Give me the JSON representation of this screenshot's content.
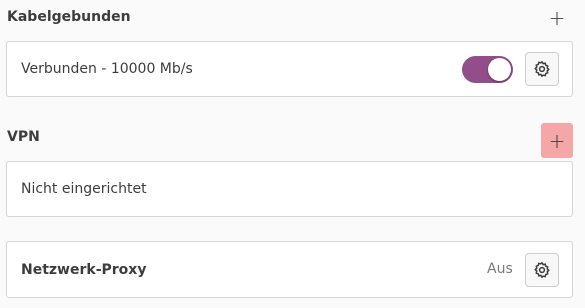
{
  "wired": {
    "title": "Kabelgebunden",
    "add_label": "+",
    "connection_label": "Verbunden - 10000 Mb/s",
    "toggle_on": true,
    "settings_icon": "gear-icon"
  },
  "vpn": {
    "title": "VPN",
    "add_label": "+",
    "status_label": "Nicht eingerichtet"
  },
  "proxy": {
    "label": "Netzwerk-Proxy",
    "status": "Aus",
    "settings_icon": "gear-icon"
  },
  "colors": {
    "toggle_accent": "#924d8b",
    "highlight": "#f5a6a6",
    "background": "#fafafa"
  }
}
